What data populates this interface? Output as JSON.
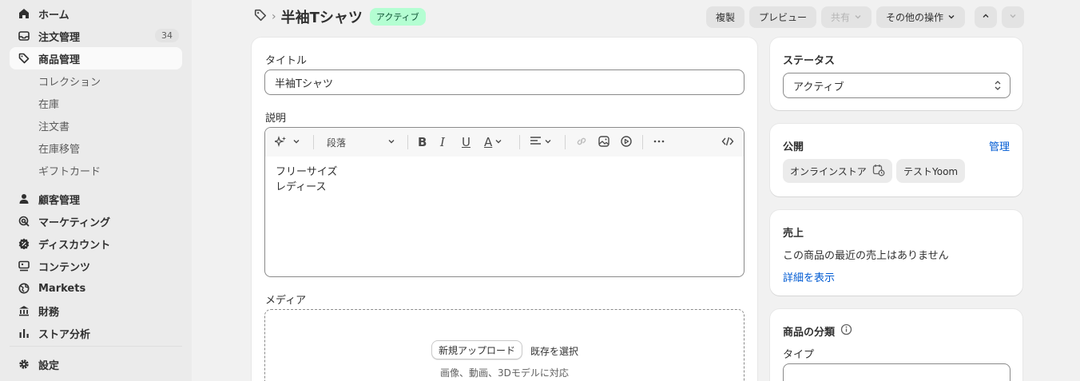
{
  "sidebar": {
    "items": [
      {
        "label": "ホーム",
        "icon": "home-icon"
      },
      {
        "label": "注文管理",
        "icon": "inbox-icon",
        "badge": "34"
      },
      {
        "label": "商品管理",
        "icon": "tag-icon"
      },
      {
        "label": "顧客管理",
        "icon": "person-icon"
      },
      {
        "label": "マーケティング",
        "icon": "target-icon"
      },
      {
        "label": "ディスカウント",
        "icon": "discount-icon"
      },
      {
        "label": "コンテンツ",
        "icon": "content-icon"
      },
      {
        "label": "Markets",
        "icon": "globe-icon"
      },
      {
        "label": "財務",
        "icon": "bank-icon"
      },
      {
        "label": "ストア分析",
        "icon": "bar-chart-icon"
      },
      {
        "label": "設定",
        "icon": "gear-icon"
      }
    ],
    "subitems": [
      "コレクション",
      "在庫",
      "注文書",
      "在庫移管",
      "ギフトカード"
    ]
  },
  "header": {
    "breadcrumb_icon": "tag-icon",
    "title": "半袖Tシャツ",
    "status_badge": "アクティブ",
    "buttons": {
      "duplicate": "複製",
      "preview": "プレビュー",
      "share": "共有",
      "more_actions": "その他の操作"
    }
  },
  "main": {
    "title_label": "タイトル",
    "title_value": "半袖Tシャツ",
    "description_label": "説明",
    "paragraph_select": "段落",
    "description_lines": [
      "フリーサイズ",
      "レディース"
    ],
    "media_label": "メディア",
    "upload_button": "新規アップロード",
    "select_existing": "既存を選択",
    "media_hint": "画像、動画、3Dモデルに対応"
  },
  "status_card": {
    "heading": "ステータス",
    "value": "アクティブ"
  },
  "publishing_card": {
    "heading": "公開",
    "manage_link": "管理",
    "channels": [
      "オンラインストア",
      "テストYoom"
    ]
  },
  "sales_card": {
    "heading": "売上",
    "text": "この商品の最近の売上はありません",
    "link": "詳細を表示"
  },
  "organization_card": {
    "heading": "商品の分類",
    "type_label": "タイプ"
  },
  "colors": {
    "accent": "#005bd3",
    "active_badge_bg": "#b4fed2",
    "active_badge_text": "#0c5132"
  }
}
